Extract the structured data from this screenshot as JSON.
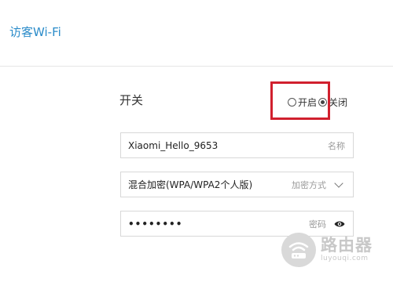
{
  "page": {
    "title": "访客Wi-Fi"
  },
  "toggle": {
    "label": "开关",
    "options": [
      {
        "label": "开启",
        "checked": false
      },
      {
        "label": "关闭",
        "checked": true
      }
    ]
  },
  "fields": {
    "ssid": {
      "value": "Xiaomi_Hello_9653",
      "hint": "名称"
    },
    "security": {
      "value": "混合加密(WPA/WPA2个人版)",
      "hint": "加密方式"
    },
    "password": {
      "value": "••••••••",
      "hint": "密码"
    }
  },
  "watermark": {
    "title": "路由器",
    "url": "luyouqi.com"
  },
  "colors": {
    "title": "#2a8bc9",
    "highlight": "#d1202e",
    "border": "#d8d8d8",
    "hint": "#9a9a9a"
  },
  "icons": {
    "security_dropdown": "chevron-down-icon",
    "password_toggle": "eye-icon",
    "watermark_logo": "router-logo-icon"
  }
}
